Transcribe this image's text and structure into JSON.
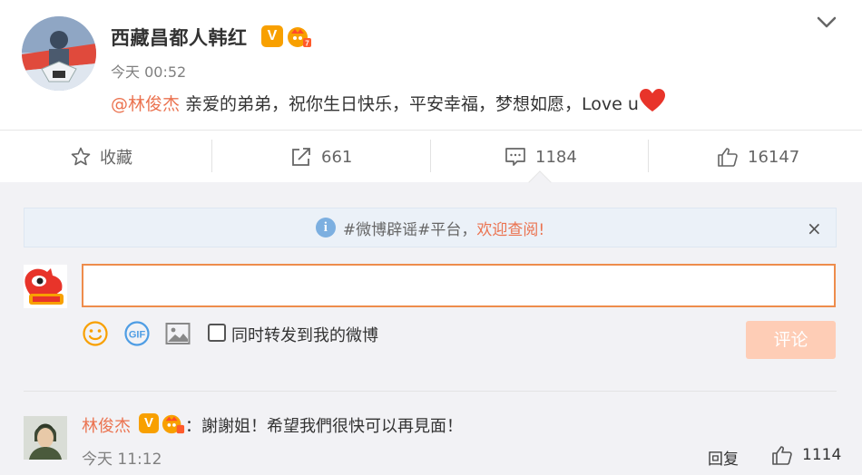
{
  "post": {
    "author": "西藏昌都人韩红",
    "time": "今天 00:52",
    "mention": "@林俊杰",
    "text": " 亲爱的弟弟，祝你生日快乐，平安幸福，梦想如愿，Love u",
    "verified_badge": "V",
    "icons": [
      "chevron-down-icon",
      "heart-icon",
      "vip-crown-icon"
    ]
  },
  "actions": {
    "favorite_label": "收藏",
    "repost_count": "661",
    "comment_count": "1184",
    "like_count": "16147"
  },
  "notice": {
    "prefix": "#微博辟谣#平台，",
    "link": "欢迎查阅!",
    "info_glyph": "i",
    "close_glyph": "×"
  },
  "composer": {
    "input_value": "",
    "repost_label": "同时转发到我的微博",
    "submit_label": "评论",
    "tools": [
      "emoji-icon",
      "gif-icon",
      "image-icon"
    ]
  },
  "comments": [
    {
      "user": "林俊杰",
      "text": "：謝謝姐！希望我們很快可以再見面！",
      "time": "今天 11:12",
      "reply_label": "回复",
      "like_count": "1114"
    }
  ],
  "colors": {
    "accent": "#eb7350",
    "badge_gold": "#f8a000",
    "input_border": "#ee8c4c",
    "submit_disabled": "#fecdb6",
    "notice_bg": "#ebf1f8"
  }
}
